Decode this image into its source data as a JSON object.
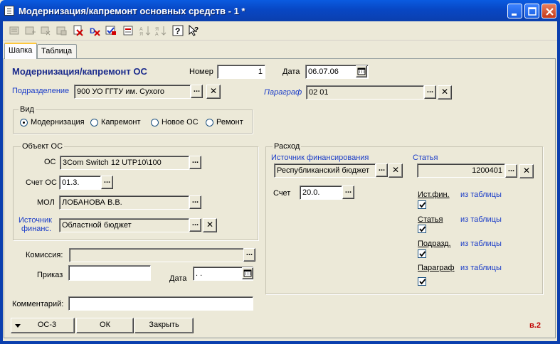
{
  "window": {
    "title": "Модернизация/капремонт основных средств - 1 *"
  },
  "tabs": [
    "Шапка",
    "Таблица"
  ],
  "header": {
    "heading": "Модернизация/капремонт ОС",
    "number_label": "Номер",
    "number_value": "1",
    "date_label": "Дата",
    "date_value": "06.07.06",
    "division_label": "Подразделение",
    "division_value": "900 УО ГГТУ им. Сухого",
    "paragraph_label": "Параграф",
    "paragraph_value": "02 01"
  },
  "vid": {
    "legend": "Вид",
    "options": [
      "Модернизация",
      "Капремонт",
      "Новое ОС",
      "Ремонт"
    ],
    "selected": "Модернизация"
  },
  "object": {
    "legend": "Объект ОС",
    "os_label": "ОС",
    "os_value": "3Com Switch 12 UTP10\\100",
    "account_label": "Счет ОС",
    "account_value": "01.3.",
    "mol_label": "МОЛ",
    "mol_value": "ЛОБАНОВА В.В.",
    "source_label_1": "Источник",
    "source_label_2": "финанс.",
    "source_value": "Областной бюджет"
  },
  "lower": {
    "commission_label": "Комиссия:",
    "commission_value": "",
    "order_label": "Приказ",
    "order_value": "",
    "order_date_label": "Дата",
    "order_date_value": " .  .",
    "comment_label": "Комментарий:",
    "comment_value": ""
  },
  "expense": {
    "legend": "Расход",
    "funding_label": "Источник финансирования",
    "funding_value": "Республиканский бюджет",
    "article_label": "Статья",
    "article_value": "1200401",
    "account_label": "Счет",
    "account_value": "20.0.",
    "flags": [
      {
        "label": "Ист.фин.",
        "note": "из таблицы",
        "checked": true
      },
      {
        "label": "Статья",
        "note": "из таблицы",
        "checked": true
      },
      {
        "label": "Подразд.",
        "note": "из таблицы",
        "checked": true
      },
      {
        "label": "Параграф",
        "note": "из таблицы",
        "checked": true
      }
    ]
  },
  "footer": {
    "form_button": "ОС-3",
    "ok_button": "ОК",
    "close_button": "Закрыть",
    "version": "в.2"
  },
  "icons": {
    "toolbar": [
      "new-doc-icon",
      "new-line-icon",
      "copy-icon",
      "edit-icon",
      "delete-icon",
      "mark-delete-icon",
      "post-icon",
      "structure-icon",
      "sort-asc-icon",
      "sort-desc-icon",
      "help-icon",
      "context-help-icon"
    ]
  }
}
